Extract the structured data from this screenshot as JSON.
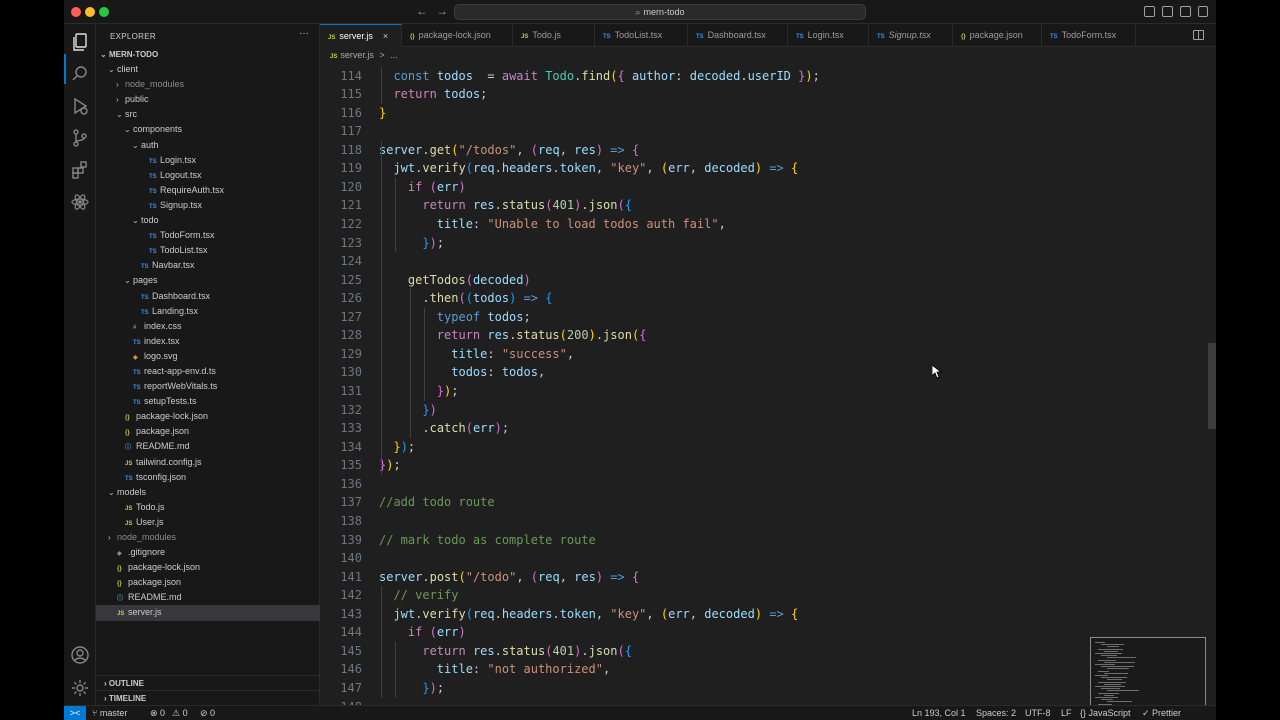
{
  "titlebar": {
    "search_text": "mern-todo"
  },
  "activity": [
    "explorer-icon",
    "search-icon",
    "run-debug-icon",
    "source-control-icon",
    "extensions-icon",
    "react-icon",
    "account-icon",
    "settings-gear-icon"
  ],
  "sidebar": {
    "title": "EXPLORER",
    "more": "···",
    "root": "MERN-TODO",
    "outline": "OUTLINE",
    "timeline": "TIMELINE",
    "items": [
      {
        "label": "client",
        "depth": 1,
        "kind": "folder-open"
      },
      {
        "label": "node_modules",
        "depth": 2,
        "kind": "folder",
        "dim": true
      },
      {
        "label": "public",
        "depth": 2,
        "kind": "folder"
      },
      {
        "label": "src",
        "depth": 2,
        "kind": "folder-open"
      },
      {
        "label": "components",
        "depth": 3,
        "kind": "folder-open"
      },
      {
        "label": "auth",
        "depth": 4,
        "kind": "folder-open"
      },
      {
        "label": "Login.tsx",
        "depth": 5,
        "kind": "ts"
      },
      {
        "label": "Logout.tsx",
        "depth": 5,
        "kind": "ts"
      },
      {
        "label": "RequireAuth.tsx",
        "depth": 5,
        "kind": "ts"
      },
      {
        "label": "Signup.tsx",
        "depth": 5,
        "kind": "ts"
      },
      {
        "label": "todo",
        "depth": 4,
        "kind": "folder-open"
      },
      {
        "label": "TodoForm.tsx",
        "depth": 5,
        "kind": "ts"
      },
      {
        "label": "TodoList.tsx",
        "depth": 5,
        "kind": "ts"
      },
      {
        "label": "Navbar.tsx",
        "depth": 4,
        "kind": "ts"
      },
      {
        "label": "pages",
        "depth": 3,
        "kind": "folder-open"
      },
      {
        "label": "Dashboard.tsx",
        "depth": 4,
        "kind": "ts"
      },
      {
        "label": "Landing.tsx",
        "depth": 4,
        "kind": "ts"
      },
      {
        "label": "index.css",
        "depth": 3,
        "kind": "css"
      },
      {
        "label": "index.tsx",
        "depth": 3,
        "kind": "ts"
      },
      {
        "label": "logo.svg",
        "depth": 3,
        "kind": "svg"
      },
      {
        "label": "react-app-env.d.ts",
        "depth": 3,
        "kind": "ts"
      },
      {
        "label": "reportWebVitals.ts",
        "depth": 3,
        "kind": "ts"
      },
      {
        "label": "setupTests.ts",
        "depth": 3,
        "kind": "ts"
      },
      {
        "label": "package-lock.json",
        "depth": 2,
        "kind": "json"
      },
      {
        "label": "package.json",
        "depth": 2,
        "kind": "json"
      },
      {
        "label": "README.md",
        "depth": 2,
        "kind": "md"
      },
      {
        "label": "tailwind.config.js",
        "depth": 2,
        "kind": "js"
      },
      {
        "label": "tsconfig.json",
        "depth": 2,
        "kind": "tsconfig"
      },
      {
        "label": "models",
        "depth": 1,
        "kind": "folder-open"
      },
      {
        "label": "Todo.js",
        "depth": 2,
        "kind": "js"
      },
      {
        "label": "User.js",
        "depth": 2,
        "kind": "js"
      },
      {
        "label": "node_modules",
        "depth": 1,
        "kind": "folder",
        "dim": true
      },
      {
        "label": ".gitignore",
        "depth": 1,
        "kind": "git"
      },
      {
        "label": "package-lock.json",
        "depth": 1,
        "kind": "json"
      },
      {
        "label": "package.json",
        "depth": 1,
        "kind": "json"
      },
      {
        "label": "README.md",
        "depth": 1,
        "kind": "md"
      },
      {
        "label": "server.js",
        "depth": 1,
        "kind": "js",
        "selected": true
      }
    ]
  },
  "tabs": [
    {
      "label": "server.js",
      "icon": "JS",
      "active": true,
      "close": "×"
    },
    {
      "label": "package-lock.json",
      "icon": "{}"
    },
    {
      "label": "Todo.js",
      "icon": "JS"
    },
    {
      "label": "TodoList.tsx",
      "icon": "TS"
    },
    {
      "label": "Dashboard.tsx",
      "icon": "TS"
    },
    {
      "label": "Login.tsx",
      "icon": "TS"
    },
    {
      "label": "Signup.tsx",
      "icon": "TS",
      "italic": true
    },
    {
      "label": "package.json",
      "icon": "{}"
    },
    {
      "label": "TodoForm.tsx",
      "icon": "TS"
    }
  ],
  "breadcrumb": {
    "file": "server.js",
    "sep": ">",
    "rest": "..."
  },
  "editor": {
    "lines": [
      {
        "n": "114",
        "ind": 1,
        "t": [
          [
            "kb",
            "const "
          ],
          [
            "vr",
            "todos"
          ],
          [
            "",
            "  = "
          ],
          [
            "kw",
            "await "
          ],
          [
            "cl",
            "Todo"
          ],
          [
            "",
            "."
          ],
          [
            "fn",
            "find"
          ],
          [
            "p1",
            "("
          ],
          [
            "p2",
            "{ "
          ],
          [
            "vr",
            "author"
          ],
          [
            "",
            ": "
          ],
          [
            "vr",
            "decoded"
          ],
          [
            "",
            "."
          ],
          [
            "vr",
            "userID "
          ],
          [
            "p2",
            "}"
          ],
          [
            "p1",
            ")"
          ],
          [
            "",
            ";"
          ]
        ]
      },
      {
        "n": "115",
        "ind": 1,
        "t": [
          [
            "kw",
            "return "
          ],
          [
            "vr",
            "todos"
          ],
          [
            "",
            ";"
          ]
        ]
      },
      {
        "n": "116",
        "ind": 0,
        "t": [
          [
            "p1",
            "}"
          ]
        ]
      },
      {
        "n": "117",
        "ind": 0,
        "t": []
      },
      {
        "n": "118",
        "ind": 0,
        "t": [
          [
            "vr",
            "server"
          ],
          [
            "",
            "."
          ],
          [
            "fn",
            "get"
          ],
          [
            "p1",
            "("
          ],
          [
            "st",
            "\"/todos\""
          ],
          [
            "",
            ", "
          ],
          [
            "p2",
            "("
          ],
          [
            "vr",
            "req"
          ],
          [
            "",
            ", "
          ],
          [
            "vr",
            "res"
          ],
          [
            "p2",
            ")"
          ],
          [
            "kb",
            " => "
          ],
          [
            "p2",
            "{"
          ]
        ]
      },
      {
        "n": "119",
        "ind": 1,
        "t": [
          [
            "vr",
            "jwt"
          ],
          [
            "",
            "."
          ],
          [
            "fn",
            "verify"
          ],
          [
            "p3",
            "("
          ],
          [
            "vr",
            "req"
          ],
          [
            "",
            "."
          ],
          [
            "vr",
            "headers"
          ],
          [
            "",
            "."
          ],
          [
            "vr",
            "token"
          ],
          [
            "",
            ", "
          ],
          [
            "st",
            "\"key\""
          ],
          [
            "",
            ", "
          ],
          [
            "p1",
            "("
          ],
          [
            "vr",
            "err"
          ],
          [
            "",
            ", "
          ],
          [
            "vr",
            "decoded"
          ],
          [
            "p1",
            ")"
          ],
          [
            "kb",
            " => "
          ],
          [
            "p1",
            "{"
          ]
        ]
      },
      {
        "n": "120",
        "ind": 2,
        "t": [
          [
            "kw",
            "if "
          ],
          [
            "p2",
            "("
          ],
          [
            "vr",
            "err"
          ],
          [
            "p2",
            ")"
          ]
        ]
      },
      {
        "n": "121",
        "ind": 3,
        "t": [
          [
            "kw",
            "return "
          ],
          [
            "vr",
            "res"
          ],
          [
            "",
            "."
          ],
          [
            "fn",
            "status"
          ],
          [
            "p2",
            "("
          ],
          [
            "nm",
            "401"
          ],
          [
            "p2",
            ")"
          ],
          [
            "",
            "."
          ],
          [
            "fn",
            "json"
          ],
          [
            "p2",
            "("
          ],
          [
            "p3",
            "{"
          ]
        ]
      },
      {
        "n": "122",
        "ind": 4,
        "t": [
          [
            "vr",
            "title"
          ],
          [
            "",
            ": "
          ],
          [
            "st",
            "\"Unable to load todos auth fail\""
          ],
          [
            "",
            ","
          ]
        ]
      },
      {
        "n": "123",
        "ind": 3,
        "t": [
          [
            "p3",
            "}"
          ],
          [
            "p2",
            ")"
          ],
          [
            "",
            ";"
          ]
        ]
      },
      {
        "n": "124",
        "ind": 0,
        "t": []
      },
      {
        "n": "125",
        "ind": 2,
        "t": [
          [
            "fn",
            "getTodos"
          ],
          [
            "p2",
            "("
          ],
          [
            "vr",
            "decoded"
          ],
          [
            "p2",
            ")"
          ]
        ]
      },
      {
        "n": "126",
        "ind": 3,
        "t": [
          [
            "",
            "."
          ],
          [
            "fn",
            "then"
          ],
          [
            "p2",
            "("
          ],
          [
            "p3",
            "("
          ],
          [
            "vr",
            "todos"
          ],
          [
            "p3",
            ")"
          ],
          [
            "kb",
            " => "
          ],
          [
            "p3",
            "{"
          ]
        ]
      },
      {
        "n": "127",
        "ind": 4,
        "t": [
          [
            "kb",
            "typeof "
          ],
          [
            "vr",
            "todos"
          ],
          [
            "",
            ";"
          ]
        ]
      },
      {
        "n": "128",
        "ind": 4,
        "t": [
          [
            "kw",
            "return "
          ],
          [
            "vr",
            "res"
          ],
          [
            "",
            "."
          ],
          [
            "fn",
            "status"
          ],
          [
            "p1",
            "("
          ],
          [
            "nm",
            "200"
          ],
          [
            "p1",
            ")"
          ],
          [
            "",
            "."
          ],
          [
            "fn",
            "json"
          ],
          [
            "p1",
            "("
          ],
          [
            "p2",
            "{"
          ]
        ]
      },
      {
        "n": "129",
        "ind": 5,
        "t": [
          [
            "vr",
            "title"
          ],
          [
            "",
            ": "
          ],
          [
            "st",
            "\"success\""
          ],
          [
            "",
            ","
          ]
        ]
      },
      {
        "n": "130",
        "ind": 5,
        "t": [
          [
            "vr",
            "todos"
          ],
          [
            "",
            ": "
          ],
          [
            "vr",
            "todos"
          ],
          [
            "",
            ","
          ]
        ]
      },
      {
        "n": "131",
        "ind": 4,
        "t": [
          [
            "p2",
            "}"
          ],
          [
            "p1",
            ")"
          ],
          [
            "",
            ";"
          ]
        ]
      },
      {
        "n": "132",
        "ind": 3,
        "t": [
          [
            "p3",
            "}"
          ],
          [
            "p2",
            ")"
          ]
        ]
      },
      {
        "n": "133",
        "ind": 3,
        "t": [
          [
            "",
            "."
          ],
          [
            "fn",
            "catch"
          ],
          [
            "p2",
            "("
          ],
          [
            "vr",
            "err"
          ],
          [
            "p2",
            ")"
          ],
          [
            "",
            ";"
          ]
        ]
      },
      {
        "n": "134",
        "ind": 1,
        "t": [
          [
            "p1",
            "}"
          ],
          [
            "p3",
            ")"
          ],
          [
            "",
            ";"
          ]
        ]
      },
      {
        "n": "135",
        "ind": 0,
        "t": [
          [
            "p2",
            "}"
          ],
          [
            "p1",
            ")"
          ],
          [
            "",
            ";"
          ]
        ]
      },
      {
        "n": "136",
        "ind": 0,
        "t": []
      },
      {
        "n": "137",
        "ind": 0,
        "t": [
          [
            "cm",
            "//add todo route"
          ]
        ]
      },
      {
        "n": "138",
        "ind": 0,
        "t": []
      },
      {
        "n": "139",
        "ind": 0,
        "t": [
          [
            "cm",
            "// mark todo as complete route"
          ]
        ]
      },
      {
        "n": "140",
        "ind": 0,
        "t": []
      },
      {
        "n": "141",
        "ind": 0,
        "t": [
          [
            "vr",
            "server"
          ],
          [
            "",
            "."
          ],
          [
            "fn",
            "post"
          ],
          [
            "p1",
            "("
          ],
          [
            "st",
            "\"/todo\""
          ],
          [
            "",
            ", "
          ],
          [
            "p2",
            "("
          ],
          [
            "vr",
            "req"
          ],
          [
            "",
            ", "
          ],
          [
            "vr",
            "res"
          ],
          [
            "p2",
            ")"
          ],
          [
            "kb",
            " => "
          ],
          [
            "p2",
            "{"
          ]
        ]
      },
      {
        "n": "142",
        "ind": 1,
        "t": [
          [
            "cm",
            "// verify"
          ]
        ]
      },
      {
        "n": "143",
        "ind": 1,
        "t": [
          [
            "vr",
            "jwt"
          ],
          [
            "",
            "."
          ],
          [
            "fn",
            "verify"
          ],
          [
            "p3",
            "("
          ],
          [
            "vr",
            "req"
          ],
          [
            "",
            "."
          ],
          [
            "vr",
            "headers"
          ],
          [
            "",
            "."
          ],
          [
            "vr",
            "token"
          ],
          [
            "",
            ", "
          ],
          [
            "st",
            "\"key\""
          ],
          [
            "",
            ", "
          ],
          [
            "p1",
            "("
          ],
          [
            "vr",
            "err"
          ],
          [
            "",
            ", "
          ],
          [
            "vr",
            "decoded"
          ],
          [
            "p1",
            ")"
          ],
          [
            "kb",
            " => "
          ],
          [
            "p1",
            "{"
          ]
        ]
      },
      {
        "n": "144",
        "ind": 2,
        "t": [
          [
            "kw",
            "if "
          ],
          [
            "p2",
            "("
          ],
          [
            "vr",
            "err"
          ],
          [
            "p2",
            ")"
          ]
        ]
      },
      {
        "n": "145",
        "ind": 3,
        "t": [
          [
            "kw",
            "return "
          ],
          [
            "vr",
            "res"
          ],
          [
            "",
            "."
          ],
          [
            "fn",
            "status"
          ],
          [
            "p2",
            "("
          ],
          [
            "nm",
            "401"
          ],
          [
            "p2",
            ")"
          ],
          [
            "",
            "."
          ],
          [
            "fn",
            "json"
          ],
          [
            "p2",
            "("
          ],
          [
            "p3",
            "{"
          ]
        ]
      },
      {
        "n": "146",
        "ind": 4,
        "t": [
          [
            "vr",
            "title"
          ],
          [
            "",
            ": "
          ],
          [
            "st",
            "\"not authorized\""
          ],
          [
            "",
            ","
          ]
        ]
      },
      {
        "n": "147",
        "ind": 3,
        "t": [
          [
            "p3",
            "}"
          ],
          [
            "p2",
            ")"
          ],
          [
            "",
            ";"
          ]
        ]
      },
      {
        "n": "148",
        "ind": 0,
        "t": []
      }
    ]
  },
  "statusbar": {
    "remote": "><",
    "branch": "master",
    "errors": "⊗ 0",
    "warnings": "⚠ 0",
    "ports": "⊘ 0",
    "position": "Ln 193, Col 1",
    "spaces": "Spaces: 2",
    "encoding": "UTF-8",
    "eol": "LF",
    "language": "{} JavaScript",
    "formatter": "✓ Prettier"
  },
  "colors": {
    "accent": "#0078d4",
    "editor_bg": "#1f1f1f",
    "sidebar_bg": "#181818"
  }
}
